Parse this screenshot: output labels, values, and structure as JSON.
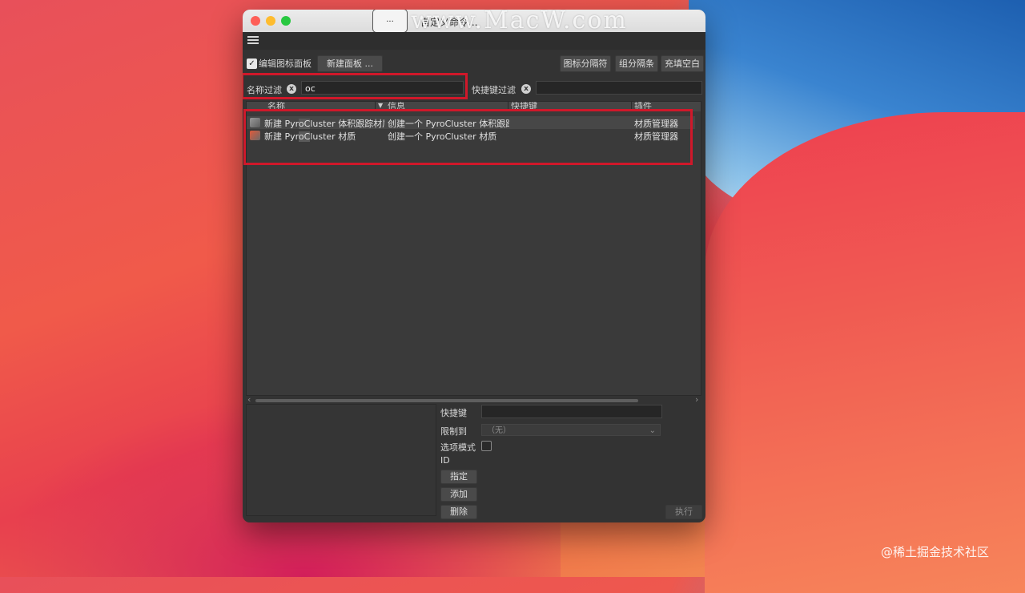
{
  "window": {
    "title": "自定义命令...",
    "title_icon_text": "..."
  },
  "watermarks": {
    "top": "www.MacW.com",
    "corner": "@稀土掘金技术社区"
  },
  "toolbar": {
    "edit_panel_checked": true,
    "edit_panel_label": "编辑图标面板",
    "new_panel_label": "新建面板 ...",
    "icon_separator_label": "图标分隔符",
    "group_separator_label": "组分隔条",
    "fill_space_label": "充填空白"
  },
  "filters": {
    "name_label": "名称过滤",
    "name_value": "oc",
    "shortcut_label": "快捷键过滤",
    "shortcut_value": "",
    "clear_icon": "x"
  },
  "table": {
    "columns": [
      "名称",
      "信息",
      "快捷键",
      "插件"
    ],
    "rows": [
      {
        "name_pre": "新建 Pyr",
        "name_hl": "oC",
        "name_post": "luster 体积跟踪材质",
        "info": "创建一个 PyroCluster 体积跟踪材质",
        "shortcut": "",
        "plugin": "材质管理器",
        "icon": "volume-material-icon"
      },
      {
        "name_pre": "新建 Pyr",
        "name_hl": "oC",
        "name_post": "luster 材质",
        "info": "创建一个 PyroCluster 材质",
        "shortcut": "",
        "plugin": "材质管理器",
        "icon": "material-icon"
      }
    ]
  },
  "scroll": {
    "left_arrow": "‹",
    "right_arrow": "›"
  },
  "details": {
    "shortcut_label": "快捷键",
    "shortcut_value": "",
    "restrict_label": "限制到",
    "restrict_value": "（无）",
    "option_mode_label": "选项模式",
    "option_mode_checked": false,
    "id_label": "ID",
    "assign_label": "指定",
    "add_label": "添加",
    "delete_label": "删除",
    "execute_label": "执行"
  },
  "colors": {
    "highlight_box": "#d0182a",
    "window_bg": "#333333"
  }
}
